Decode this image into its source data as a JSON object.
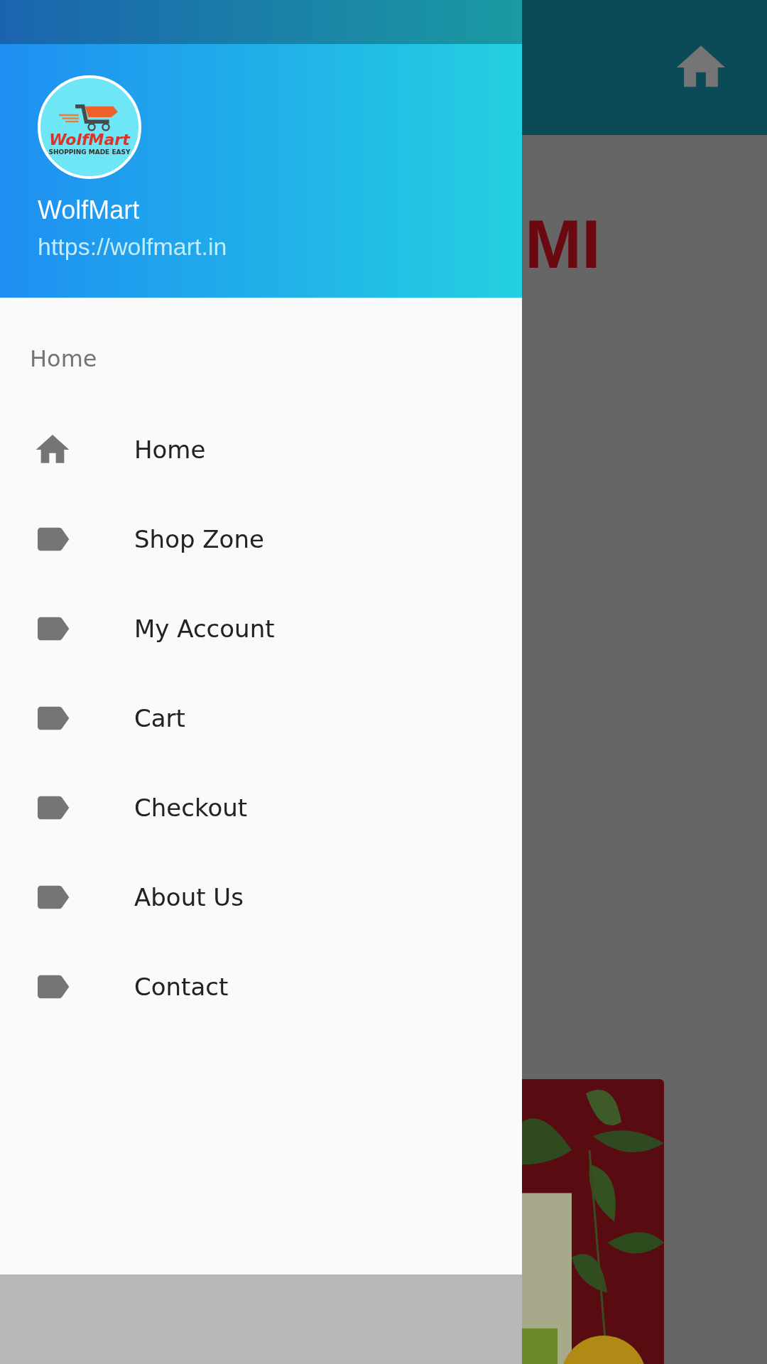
{
  "drawer": {
    "logo": {
      "name": "WolfMart",
      "tagline": "SHOPPING MADE EASY"
    },
    "title": "WolfMart",
    "subtitle": "https://wolfmart.in",
    "section": "Home",
    "items": [
      {
        "label": "Home",
        "kind": "home"
      },
      {
        "label": "Shop Zone",
        "kind": "label"
      },
      {
        "label": "My Account",
        "kind": "label"
      },
      {
        "label": "Cart",
        "kind": "label"
      },
      {
        "label": "Checkout",
        "kind": "label"
      },
      {
        "label": "About Us",
        "kind": "label"
      },
      {
        "label": "Contact",
        "kind": "label"
      }
    ]
  },
  "background": {
    "banner_text": "MI"
  }
}
